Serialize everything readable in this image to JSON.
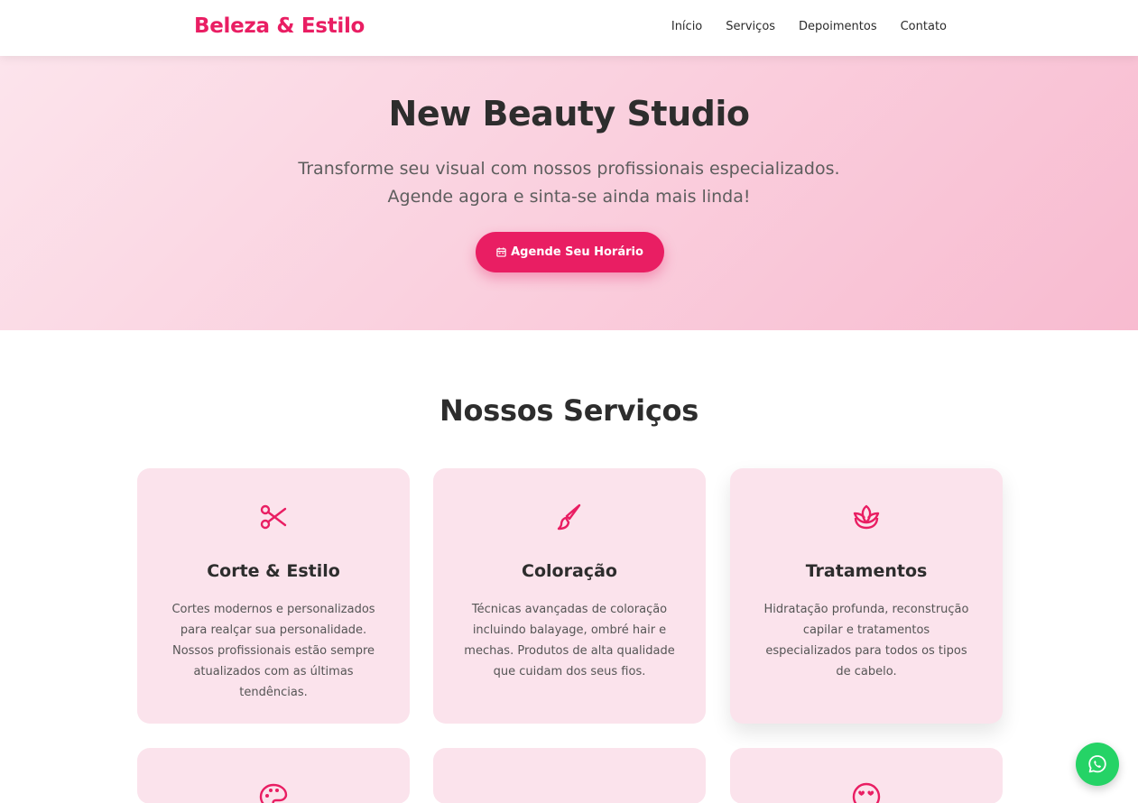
{
  "nav": {
    "brand": "Beleza & Estilo",
    "links": [
      "Início",
      "Serviços",
      "Depoimentos",
      "Contato"
    ]
  },
  "hero": {
    "title": "New Beauty Studio",
    "subtitle_line1": "Transforme seu visual com nossos profissionais especializados.",
    "subtitle_line2": "Agende agora e sinta-se ainda mais linda!",
    "cta_label": "Agende Seu Horário",
    "cta_icon": "calendar-icon"
  },
  "services": {
    "title": "Nossos Serviços",
    "cards": [
      {
        "icon": "scissors-icon",
        "title": "Corte & Estilo",
        "text": "Cortes modernos e personalizados para realçar sua personalidade. Nossos profissionais estão sempre atualizados com as últimas tendências."
      },
      {
        "icon": "brush-icon",
        "title": "Coloração",
        "text": "Técnicas avançadas de coloração incluindo balayage, ombré hair e mechas. Produtos de alta qualidade que cuidam dos seus fios."
      },
      {
        "icon": "lotus-icon",
        "title": "Tratamentos",
        "text": "Hidratação profunda, reconstrução capilar e tratamentos especializados para todos os tipos de cabelo."
      }
    ],
    "second_row_icons": [
      "palette-icon",
      "",
      "heart-eyes-icon"
    ]
  },
  "colors": {
    "accent": "#e91e63",
    "card_bg": "#fbe3ec",
    "whatsapp": "#25d366"
  },
  "whatsapp_icon": "whatsapp-icon"
}
